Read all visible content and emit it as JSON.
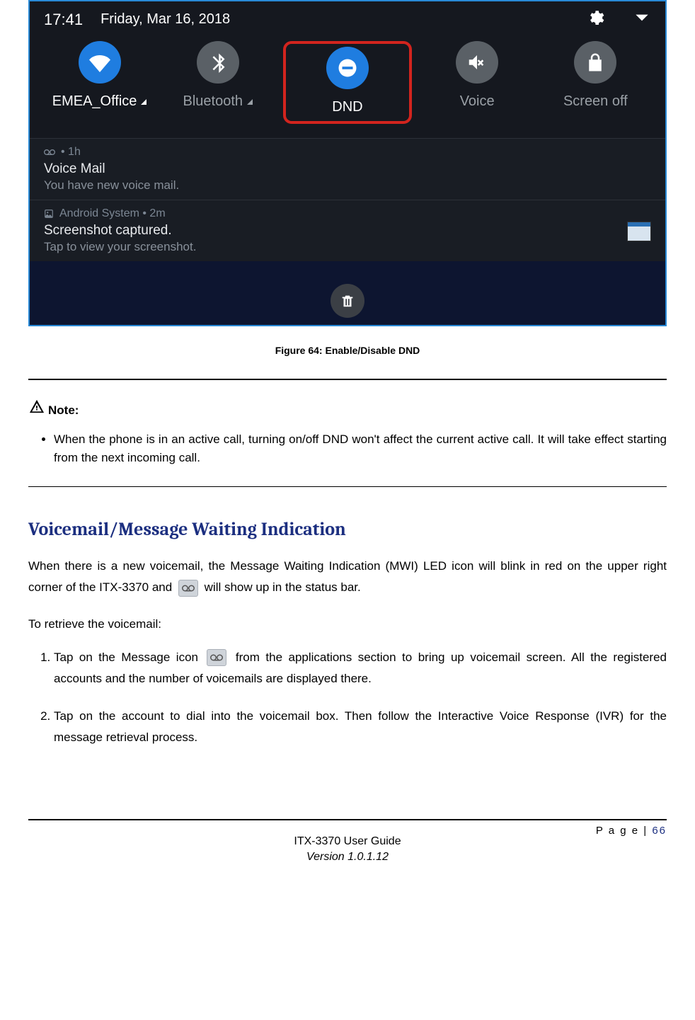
{
  "screenshot": {
    "time": "17:41",
    "date": "Friday, Mar 16, 2018",
    "toggles": {
      "wifi": "EMEA_Office",
      "bluetooth": "Bluetooth",
      "dnd": "DND",
      "voice": "Voice",
      "screen": "Screen off"
    },
    "notif1": {
      "meta": "  • 1h",
      "title": "Voice Mail",
      "sub": "You have new voice mail."
    },
    "notif2": {
      "meta": "Android System • 2m",
      "title": "Screenshot captured.",
      "sub": "Tap to view your screenshot."
    }
  },
  "figure_caption": "Figure 64: Enable/Disable DND",
  "note_label": "Note:",
  "note_bullet": "When the phone is in an active call, turning on/off DND won't affect the current active call. It will take effect starting from the next incoming call.",
  "heading": "Voicemail/Message Waiting Indication",
  "para1a": "When there is a new voicemail, the Message Waiting Indication (MWI) LED icon will blink in red on the upper right corner of the ITX-3370 and ",
  "para1b": " will show up in the status bar.",
  "retrieve_label": "To retrieve the voicemail:",
  "step1a": "Tap on the Message icon ",
  "step1b": "from the applications section to bring up voicemail screen. All the registered accounts and the number of voicemails are displayed there.",
  "step2": "Tap on the account to dial into the voicemail box. Then follow the Interactive Voice Response (IVR) for the message retrieval process.",
  "footer": {
    "page_label": "P a g e | ",
    "page_num": "66",
    "doc": "ITX-3370 User Guide",
    "ver": "Version 1.0.1.12"
  }
}
